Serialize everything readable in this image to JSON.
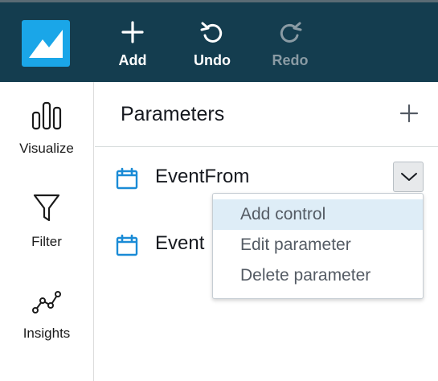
{
  "toolbar": {
    "add_label": "Add",
    "undo_label": "Undo",
    "redo_label": "Redo",
    "redo_disabled": true
  },
  "sidebar": {
    "items": [
      {
        "label": "Visualize",
        "icon": "bar-chart-icon"
      },
      {
        "label": "Filter",
        "icon": "funnel-icon"
      },
      {
        "label": "Insights",
        "icon": "line-insights-icon"
      }
    ]
  },
  "panel": {
    "title": "Parameters",
    "parameters": [
      {
        "name": "EventFrom",
        "icon": "calendar-icon"
      },
      {
        "name": "Event",
        "icon": "calendar-icon"
      }
    ]
  },
  "context_menu": {
    "items": [
      {
        "label": "Add control",
        "highlighted": true
      },
      {
        "label": "Edit parameter",
        "highlighted": false
      },
      {
        "label": "Delete parameter",
        "highlighted": false
      }
    ]
  },
  "colors": {
    "topbar": "#143d4f",
    "logo": "#1aa6e8",
    "accent": "#1a8bd6",
    "menu_highlight": "#deedf7"
  }
}
